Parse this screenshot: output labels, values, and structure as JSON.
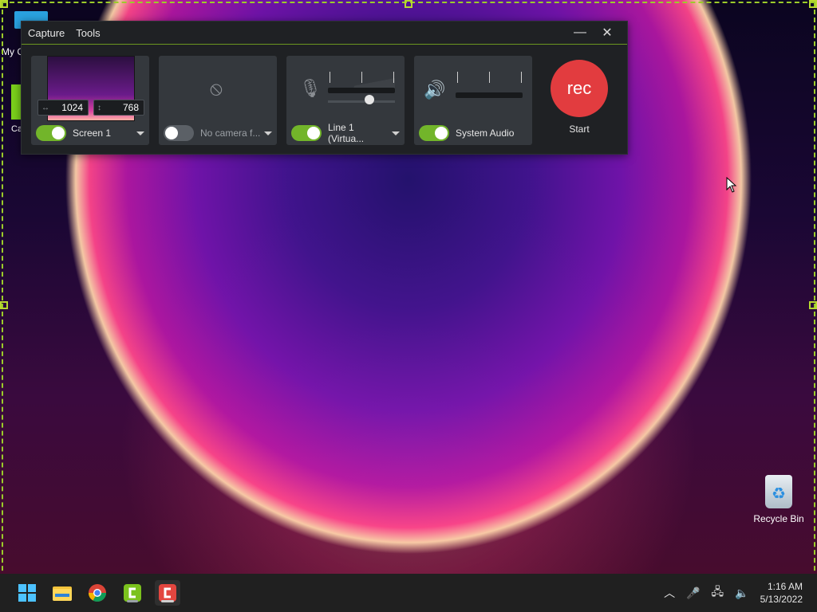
{
  "capture": {
    "menus": [
      "Capture",
      "Tools"
    ],
    "controls": {
      "minimize_icon": "minimize-icon",
      "close_icon": "close-icon"
    },
    "screen": {
      "width": "1024",
      "height": "768",
      "label": "Screen 1"
    },
    "camera": {
      "label": "No camera f..."
    },
    "microphone": {
      "label": "Line 1 (Virtua..."
    },
    "system_audio": {
      "label": "System Audio"
    },
    "record": {
      "button": "rec",
      "label": "Start"
    }
  },
  "desktop": {
    "left_label_1": "My C",
    "left_label_2": "Ca",
    "recycle_bin": "Recycle Bin"
  },
  "taskbar": {
    "time": "1:16 AM",
    "date": "5/13/2022"
  },
  "colors": {
    "accent_green": "#72b52a",
    "rec_red": "#e23c3f",
    "selection": "#9ccc2a"
  }
}
